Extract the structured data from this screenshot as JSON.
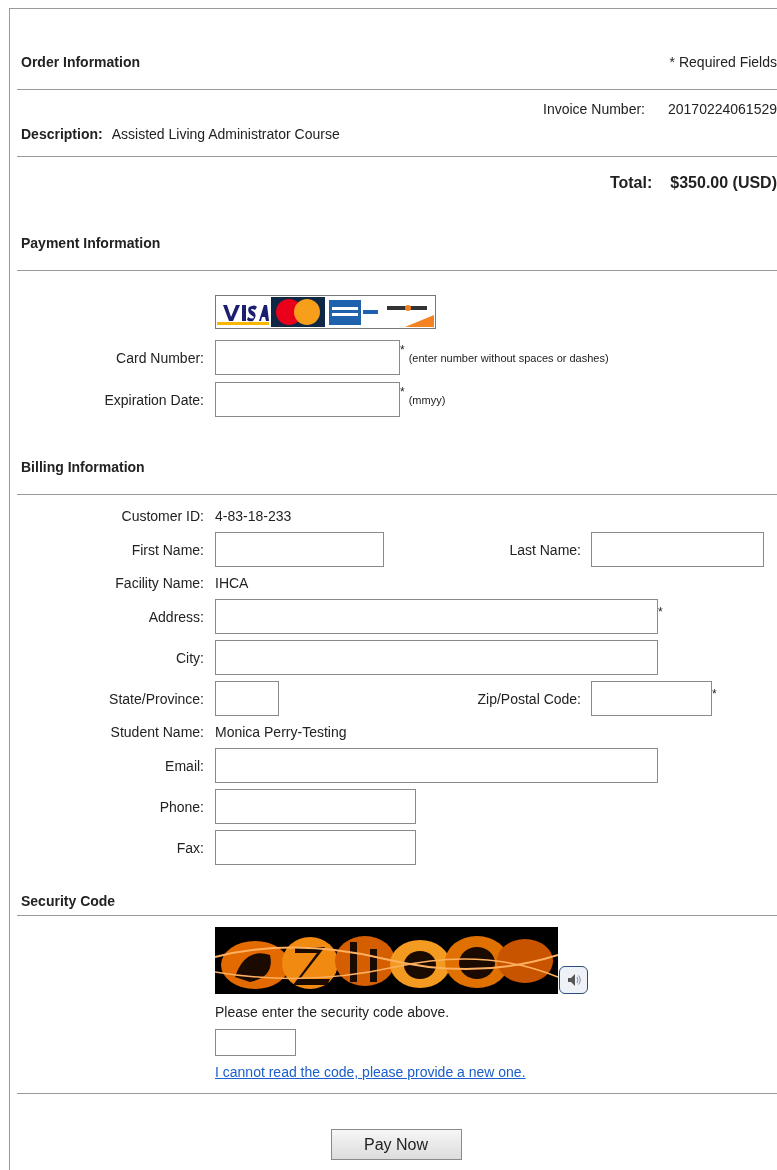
{
  "order": {
    "title": "Order Information",
    "required_note": "* Required Fields",
    "invoice_label": "Invoice Number:",
    "invoice_number": "20170224061529",
    "description_label": "Description:",
    "description": "Assisted Living Administrator Course",
    "total_label": "Total:",
    "total": "$350.00 (USD)"
  },
  "payment": {
    "title": "Payment Information",
    "fields": [
      {
        "label": "Card Number:",
        "required_mark": "*",
        "hint": "(enter number without spaces or dashes)"
      },
      {
        "label": "Expiration Date:",
        "required_mark": "*",
        "hint": "(mmyy)"
      }
    ]
  },
  "billing": {
    "title": "Billing Information",
    "rows": [
      {
        "kind": "text",
        "label": "Customer ID:",
        "value": "4-83-18-233"
      },
      {
        "kind": "name_pair",
        "fields": [
          {
            "label": "First Name:"
          },
          {
            "label": "Last Name:"
          }
        ]
      },
      {
        "kind": "text",
        "label": "Facility Name:",
        "value": "IHCA"
      },
      {
        "kind": "wide_field",
        "label": "Address:",
        "required_mark": "*"
      },
      {
        "kind": "wide_field",
        "label": "City:"
      },
      {
        "kind": "region_pair",
        "fields": [
          {
            "label": "State/Province:"
          },
          {
            "label": "Zip/Postal Code:",
            "required_mark": "*"
          }
        ]
      },
      {
        "kind": "text",
        "label": "Student Name:",
        "value": "Monica Perry-Testing"
      },
      {
        "kind": "wide_field",
        "label": "Email:"
      },
      {
        "kind": "field",
        "label": "Phone:"
      },
      {
        "kind": "field",
        "label": "Fax:"
      }
    ]
  },
  "security": {
    "title": "Security Code",
    "prompt": "Please enter the security code above.",
    "new_code_link": "I cannot read the code, please provide a new one."
  },
  "submit": "Pay Now"
}
